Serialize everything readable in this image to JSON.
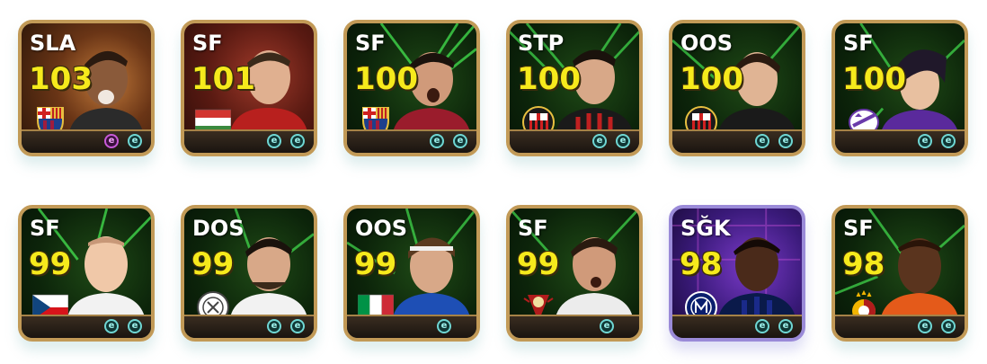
{
  "cards": [
    {
      "position": "SLA",
      "rating": "103",
      "badge": "barcelona-crest-icon",
      "theme": "gold",
      "skills": [
        "e",
        "e"
      ],
      "skill_colors": [
        "purple",
        "teal"
      ]
    },
    {
      "position": "SF",
      "rating": "101",
      "badge": "hungary-flag-icon",
      "theme": "gold",
      "skills": [
        "e",
        "e"
      ],
      "skill_colors": [
        "teal",
        "teal"
      ]
    },
    {
      "position": "SF",
      "rating": "100",
      "badge": "barcelona-crest-icon",
      "theme": "green",
      "skills": [
        "e",
        "e"
      ],
      "skill_colors": [
        "teal",
        "teal"
      ]
    },
    {
      "position": "STP",
      "rating": "100",
      "badge": "ac-milan-crest-icon",
      "theme": "green",
      "skills": [
        "e",
        "e"
      ],
      "skill_colors": [
        "teal",
        "teal"
      ]
    },
    {
      "position": "OOS",
      "rating": "100",
      "badge": "ac-milan-crest-icon",
      "theme": "green",
      "skills": [
        "e",
        "e"
      ],
      "skill_colors": [
        "teal",
        "teal"
      ]
    },
    {
      "position": "SF",
      "rating": "100",
      "badge": "fiorentina-crest-icon",
      "theme": "green",
      "skills": [
        "e",
        "e"
      ],
      "skill_colors": [
        "teal",
        "teal"
      ]
    },
    {
      "position": "SF",
      "rating": "99",
      "badge": "czech-flag-icon",
      "theme": "green",
      "skills": [
        "e",
        "e"
      ],
      "skill_colors": [
        "teal",
        "teal"
      ]
    },
    {
      "position": "DOS",
      "rating": "99",
      "badge": "club-crest-icon",
      "theme": "green",
      "skills": [
        "e",
        "e"
      ],
      "skill_colors": [
        "teal",
        "teal"
      ]
    },
    {
      "position": "OOS",
      "rating": "99",
      "badge": "italy-flag-icon",
      "theme": "green",
      "skills": [
        "e"
      ],
      "skill_colors": [
        "teal"
      ]
    },
    {
      "position": "SF",
      "rating": "99",
      "badge": "club-crest-icon",
      "theme": "green",
      "skills": [
        "e"
      ],
      "skill_colors": [
        "teal"
      ]
    },
    {
      "position": "SĞK",
      "rating": "98",
      "badge": "inter-crest-icon",
      "theme": "purple",
      "skills": [
        "e",
        "e"
      ],
      "skill_colors": [
        "teal",
        "teal"
      ]
    },
    {
      "position": "SF",
      "rating": "98",
      "badge": "galatasaray-crest-icon",
      "theme": "green",
      "skills": [
        "e",
        "e"
      ],
      "skill_colors": [
        "teal",
        "teal"
      ]
    }
  ],
  "colors": {
    "rating": "#f6ea1c",
    "frame_gold": "#c29a57",
    "frame_epic": "#9a8ad8",
    "neon_green": "#4cff5a",
    "skill_teal": "#6fd6d3",
    "skill_purple": "#c85ad8"
  }
}
